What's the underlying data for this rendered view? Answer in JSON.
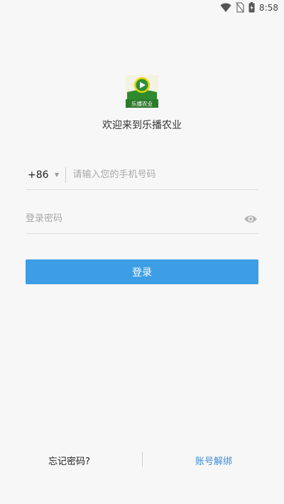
{
  "status_bar": {
    "time": "8:58",
    "icons": [
      "wifi-icon",
      "no-sim-icon",
      "battery-charging-icon"
    ]
  },
  "logo": {
    "icon": "play-logo-icon",
    "caption": "乐播农业"
  },
  "welcome_text": "欢迎来到乐播农业",
  "phone": {
    "country_code": "+86",
    "dropdown_icon": "triangle-down-icon",
    "placeholder": "请输入您的手机号码"
  },
  "password": {
    "placeholder": "登录密码",
    "toggle_icon": "eye-icon"
  },
  "login_button": "登录",
  "bottom": {
    "forgot": "忘记密码?",
    "unbind": "账号解绑"
  },
  "colors": {
    "accent": "#3d9ee6",
    "link": "#3d8fd6",
    "background": "#f7f7f7"
  }
}
